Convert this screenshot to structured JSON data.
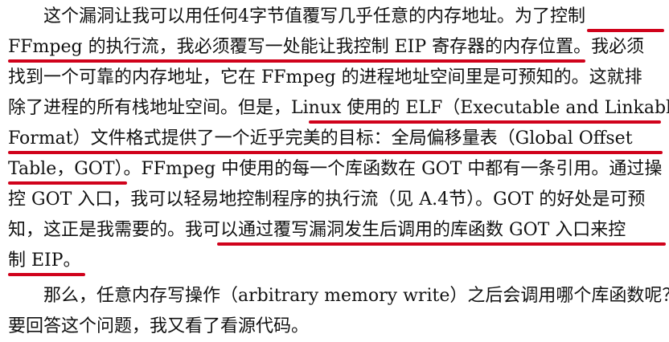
{
  "document": {
    "lines": [
      "这个漏洞让我可以用任何4字节值覆写几乎任意的内存地址。为了控制",
      "FFmpeg 的执行流，我必须覆写一处能让我控制 EIP 寄存器的内存位置。我必须",
      "找到一个可靠的内存地址，它在 FFmpeg 的进程地址空间里是可预知的。这就排",
      "除了进程的所有栈地址空间。但是，Linux 使用的 ELF（Executable and Linkable",
      "Format）文件格式提供了一个近乎完美的目标：全局偏移量表（Global Offset",
      "Table，GOT）。FFmpeg 中使用的每一个库函数在 GOT 中都有一条引用。通过操",
      "控 GOT 入口，我可以轻易地控制程序的执行流（见 A.4节）。GOT 的好处是可预",
      "知，这正是我需要的。我可以通过覆写漏洞发生后调用的库函数 GOT 入口来控",
      "制 EIP。",
      "那么，任意内存写操作（arbitrary memory write）之后会调用哪个库函数呢？",
      "要回答这个问题，我又看了看源代码。"
    ]
  },
  "annotations": {
    "underline_color": "#d0021b"
  }
}
